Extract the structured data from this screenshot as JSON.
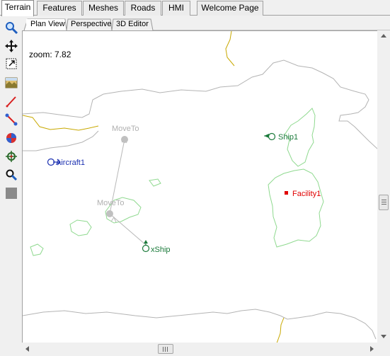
{
  "main_tabs": [
    {
      "label": "Terrain",
      "active": true
    },
    {
      "label": "Features",
      "active": false
    },
    {
      "label": "Meshes",
      "active": false
    },
    {
      "label": "Roads",
      "active": false
    },
    {
      "label": "HMI",
      "active": false
    },
    {
      "label": "Welcome Page",
      "active": false
    }
  ],
  "sub_tabs": [
    {
      "label": "Plan View",
      "active": true
    },
    {
      "label": "Perspective",
      "active": false
    },
    {
      "label": "3D Editor",
      "active": false
    }
  ],
  "toolbar": [
    {
      "icon": "magnifier-icon"
    },
    {
      "icon": "pan-arrows-icon"
    },
    {
      "icon": "zoom-box-icon"
    },
    {
      "icon": "terrain-image-icon"
    },
    {
      "icon": "draw-line-icon"
    },
    {
      "icon": "measure-icon"
    },
    {
      "icon": "globe-icon"
    },
    {
      "icon": "crosshair-icon"
    },
    {
      "icon": "find-icon"
    },
    {
      "icon": "gray-square-icon"
    }
  ],
  "map": {
    "zoom_text": "zoom: 7.82",
    "waypoints": [
      "MoveTo",
      "MoveTo"
    ],
    "entities": {
      "ship1": "Ship1",
      "aircraft1": "Aircraft1",
      "facility1": "Facility1",
      "xship": "xShip"
    },
    "colors": {
      "coastline": "#b4b4b4",
      "island": "#8fd98f",
      "border": "#c8a800",
      "route": "#b8b8b8",
      "waypoint_text": "#b0b0b0",
      "ship": "#1a7a3a",
      "aircraft": "#1a2fb0",
      "facility": "#e00000"
    }
  }
}
